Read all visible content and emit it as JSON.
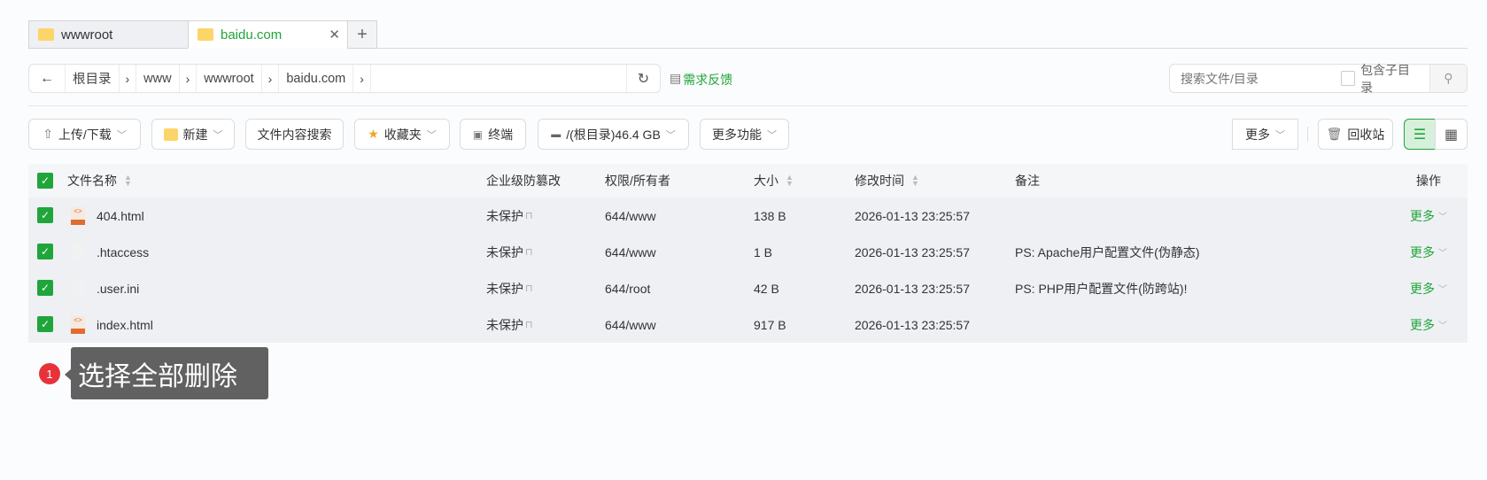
{
  "tabs": [
    {
      "label": "wwwroot",
      "active": false
    },
    {
      "label": "baidu.com",
      "active": true
    }
  ],
  "breadcrumb": [
    "根目录",
    "www",
    "wwwroot",
    "baidu.com"
  ],
  "feedback": "需求反馈",
  "search": {
    "placeholder": "搜索文件/目录",
    "include_sub": "包含子目录"
  },
  "toolbar": {
    "upload": "上传/下载",
    "new": "新建",
    "content_search": "文件内容搜索",
    "favorites": "收藏夹",
    "terminal": "终端",
    "disk": "/(根目录)46.4 GB",
    "more_features": "更多功能",
    "more": "更多",
    "recycle": "回收站"
  },
  "columns": {
    "name": "文件名称",
    "tamper": "企业级防篡改",
    "perm": "权限/所有者",
    "size": "大小",
    "mtime": "修改时间",
    "note": "备注",
    "action": "操作"
  },
  "rows": [
    {
      "name": "404.html",
      "type": "html",
      "tamper": "未保护",
      "perm": "644/www",
      "size": "138 B",
      "mtime": "2026-01-13 23:25:57",
      "note": "",
      "action": "更多"
    },
    {
      "name": ".htaccess",
      "type": "text",
      "tamper": "未保护",
      "perm": "644/www",
      "size": "1 B",
      "mtime": "2026-01-13 23:25:57",
      "note": "PS: Apache用户配置文件(伪静态)",
      "action": "更多"
    },
    {
      "name": ".user.ini",
      "type": "text",
      "tamper": "未保护",
      "perm": "644/root",
      "size": "42 B",
      "mtime": "2026-01-13 23:25:57",
      "note": "PS: PHP用户配置文件(防跨站)!",
      "action": "更多"
    },
    {
      "name": "index.html",
      "type": "html",
      "tamper": "未保护",
      "perm": "644/www",
      "size": "917 B",
      "mtime": "2026-01-13 23:25:57",
      "note": "",
      "action": "更多"
    }
  ],
  "annotation": {
    "number": "1",
    "text": "选择全部删除"
  },
  "colors": {
    "accent": "#20a53a"
  }
}
